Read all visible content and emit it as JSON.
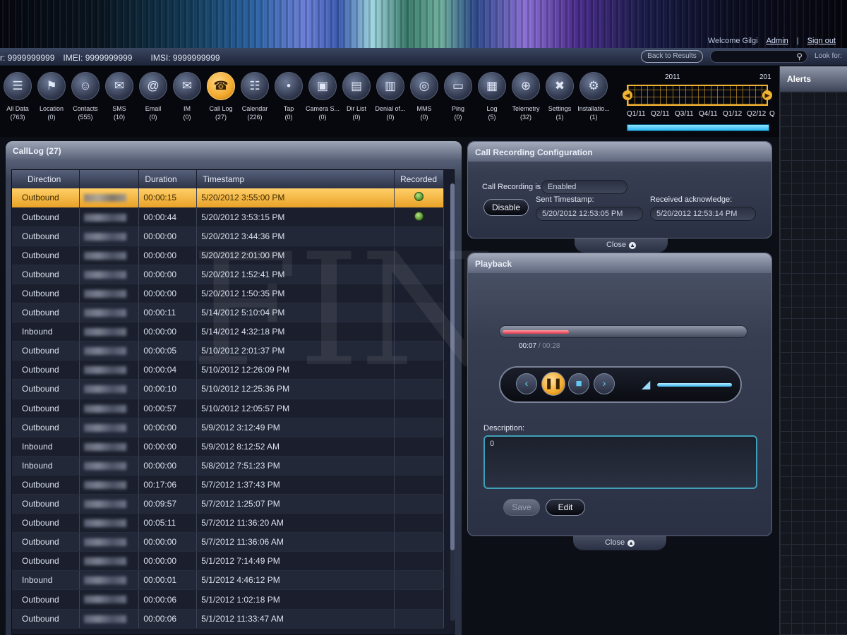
{
  "header": {
    "welcome": "Welcome Gilgi",
    "admin_link": "Admin",
    "separator": "|",
    "signout_link": "Sign out"
  },
  "idbar": {
    "prefix_tail": "r: 9999999999",
    "imei": "IMEI: 9999999999",
    "imsi": "IMSI: 9999999999",
    "back_button": "Back to Results",
    "search_placeholder": "",
    "look_for": "Look for:"
  },
  "toolbar": {
    "items": [
      {
        "label": "All Data",
        "count": "(763)",
        "icon": "data-icon"
      },
      {
        "label": "Location",
        "count": "(0)",
        "icon": "location-pin-icon"
      },
      {
        "label": "Contacts",
        "count": "(555)",
        "icon": "contacts-icon"
      },
      {
        "label": "SMS",
        "count": "(10)",
        "icon": "envelope-icon"
      },
      {
        "label": "Email",
        "count": "(0)",
        "icon": "at-icon"
      },
      {
        "label": "IM",
        "count": "(0)",
        "icon": "chat-icon"
      },
      {
        "label": "Call Log",
        "count": "(27)",
        "icon": "phone-icon",
        "active": true
      },
      {
        "label": "Calendar",
        "count": "(226)",
        "icon": "calendar-icon"
      },
      {
        "label": "Tap",
        "count": "(0)",
        "icon": "microphone-icon"
      },
      {
        "label": "Camera S...",
        "count": "(0)",
        "icon": "camera-icon"
      },
      {
        "label": "Dir List",
        "count": "(0)",
        "icon": "directory-icon"
      },
      {
        "label": "Denial of...",
        "count": "(0)",
        "icon": "denial-icon"
      },
      {
        "label": "MMS",
        "count": "(0)",
        "icon": "globe-icon"
      },
      {
        "label": "Ping",
        "count": "(0)",
        "icon": "monitor-icon"
      },
      {
        "label": "Log",
        "count": "(5)",
        "icon": "log-icon"
      },
      {
        "label": "Telemetry",
        "count": "(32)",
        "icon": "telemetry-icon"
      },
      {
        "label": "Settings",
        "count": "(1)",
        "icon": "tools-icon"
      },
      {
        "label": "Installatio...",
        "count": "(1)",
        "icon": "gear-icon"
      }
    ]
  },
  "timeline": {
    "year1": "2011",
    "year2": "201",
    "quarters": [
      "Q1/11",
      "Q2/11",
      "Q3/11",
      "Q4/11",
      "Q1/12",
      "Q2/12",
      "Q"
    ]
  },
  "alerts": {
    "title": "Alerts"
  },
  "calllog": {
    "title": "CallLog (27)",
    "columns": [
      "Direction",
      "",
      "Duration",
      "Timestamp",
      "Recorded"
    ],
    "rows": [
      {
        "direction": "Outbound",
        "duration": "00:00:15",
        "timestamp": "5/20/2012 3:55:00 PM",
        "recorded": true,
        "selected": true
      },
      {
        "direction": "Outbound",
        "duration": "00:00:44",
        "timestamp": "5/20/2012 3:53:15 PM",
        "recorded": true
      },
      {
        "direction": "Outbound",
        "duration": "00:00:00",
        "timestamp": "5/20/2012 3:44:36 PM"
      },
      {
        "direction": "Outbound",
        "duration": "00:00:00",
        "timestamp": "5/20/2012 2:01:00 PM"
      },
      {
        "direction": "Outbound",
        "duration": "00:00:00",
        "timestamp": "5/20/2012 1:52:41 PM"
      },
      {
        "direction": "Outbound",
        "duration": "00:00:00",
        "timestamp": "5/20/2012 1:50:35 PM"
      },
      {
        "direction": "Outbound",
        "duration": "00:00:11",
        "timestamp": "5/14/2012 5:10:04 PM"
      },
      {
        "direction": "Inbound",
        "duration": "00:00:00",
        "timestamp": "5/14/2012 4:32:18 PM"
      },
      {
        "direction": "Outbound",
        "duration": "00:00:05",
        "timestamp": "5/10/2012 2:01:37 PM"
      },
      {
        "direction": "Outbound",
        "duration": "00:00:04",
        "timestamp": "5/10/2012 12:26:09 PM"
      },
      {
        "direction": "Outbound",
        "duration": "00:00:10",
        "timestamp": "5/10/2012 12:25:36 PM"
      },
      {
        "direction": "Outbound",
        "duration": "00:00:57",
        "timestamp": "5/10/2012 12:05:57 PM"
      },
      {
        "direction": "Outbound",
        "duration": "00:00:00",
        "timestamp": "5/9/2012 3:12:49 PM"
      },
      {
        "direction": "Inbound",
        "duration": "00:00:00",
        "timestamp": "5/9/2012 8:12:52 AM"
      },
      {
        "direction": "Inbound",
        "duration": "00:00:00",
        "timestamp": "5/8/2012 7:51:23 PM"
      },
      {
        "direction": "Outbound",
        "duration": "00:17:06",
        "timestamp": "5/7/2012 1:37:43 PM"
      },
      {
        "direction": "Outbound",
        "duration": "00:09:57",
        "timestamp": "5/7/2012 1:25:07 PM"
      },
      {
        "direction": "Outbound",
        "duration": "00:05:11",
        "timestamp": "5/7/2012 11:36:20 AM"
      },
      {
        "direction": "Outbound",
        "duration": "00:00:00",
        "timestamp": "5/7/2012 11:36:06 AM"
      },
      {
        "direction": "Outbound",
        "duration": "00:00:00",
        "timestamp": "5/1/2012 7:14:49 PM"
      },
      {
        "direction": "Inbound",
        "duration": "00:00:01",
        "timestamp": "5/1/2012 4:46:12 PM"
      },
      {
        "direction": "Outbound",
        "duration": "00:00:06",
        "timestamp": "5/1/2012 1:02:18 PM"
      },
      {
        "direction": "Outbound",
        "duration": "00:00:06",
        "timestamp": "5/1/2012 11:33:47 AM"
      }
    ]
  },
  "recording_config": {
    "title": "Call Recording Configuration",
    "status_label": "Call Recording is:",
    "status_value": "Enabled",
    "disable_button": "Disable",
    "sent_label": "Sent Timestamp:",
    "sent_value": "5/20/2012 12:53:05 PM",
    "received_label": "Received acknowledge:",
    "received_value": "5/20/2012 12:53:14 PM",
    "close_label": "Close"
  },
  "playback": {
    "title": "Playback",
    "current_time": "00:07",
    "time_sep": "/",
    "total_time": "00:28",
    "progress_fraction": 0.25,
    "volume_fraction": 1.0,
    "description_label": "Description:",
    "description_value": "0",
    "save_button": "Save",
    "edit_button": "Edit",
    "close_label": "Close"
  },
  "colors": {
    "accent": "#f2a92b",
    "highlight_row": "#f0b232",
    "description_border": "#3f9fb7"
  }
}
